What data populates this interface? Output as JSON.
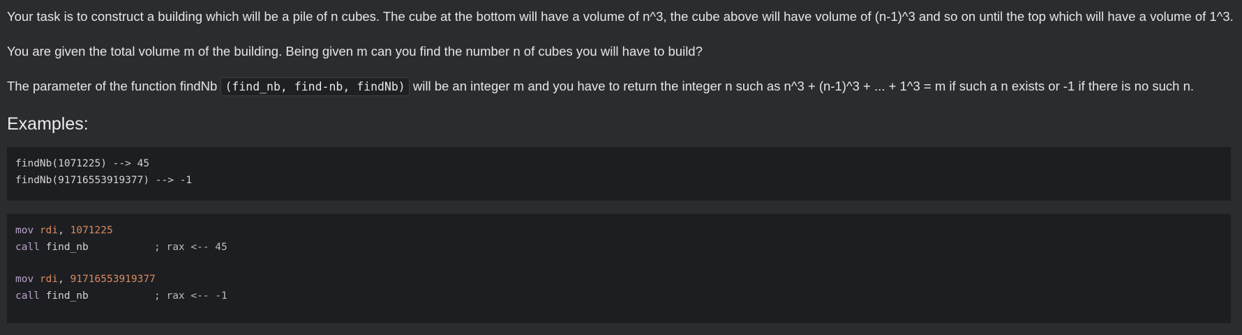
{
  "description": {
    "p1": "Your task is to construct a building which will be a pile of n cubes. The cube at the bottom will have a volume of n^3, the cube above will have volume of (n-1)^3 and so on until the top which will have a volume of 1^3.",
    "p2": "You are given the total volume m of the building. Being given m can you find the number n of cubes you will have to build?",
    "p3_before": "The parameter of the function findNb ",
    "p3_code": "(find_nb, find-nb, findNb)",
    "p3_after": " will be an integer m and you have to return the integer n such as n^3 + (n-1)^3 + ... + 1^3 = m if such a n exists or -1 if there is no such n."
  },
  "examples": {
    "heading": "Examples:",
    "block1": [
      "findNb(1071225) --> 45",
      "findNb(91716553919377) --> -1"
    ],
    "block2": {
      "ex1": {
        "mov": "mov",
        "reg": "rdi",
        "sep": ", ",
        "num": "1071225",
        "call": "call",
        "fn": "find_nb",
        "comment": "; rax <-- 45"
      },
      "ex2": {
        "mov": "mov",
        "reg": "rdi",
        "sep": ", ",
        "num": "91716553919377",
        "call": "call",
        "fn": "find_nb",
        "comment": "; rax <-- -1"
      }
    }
  }
}
